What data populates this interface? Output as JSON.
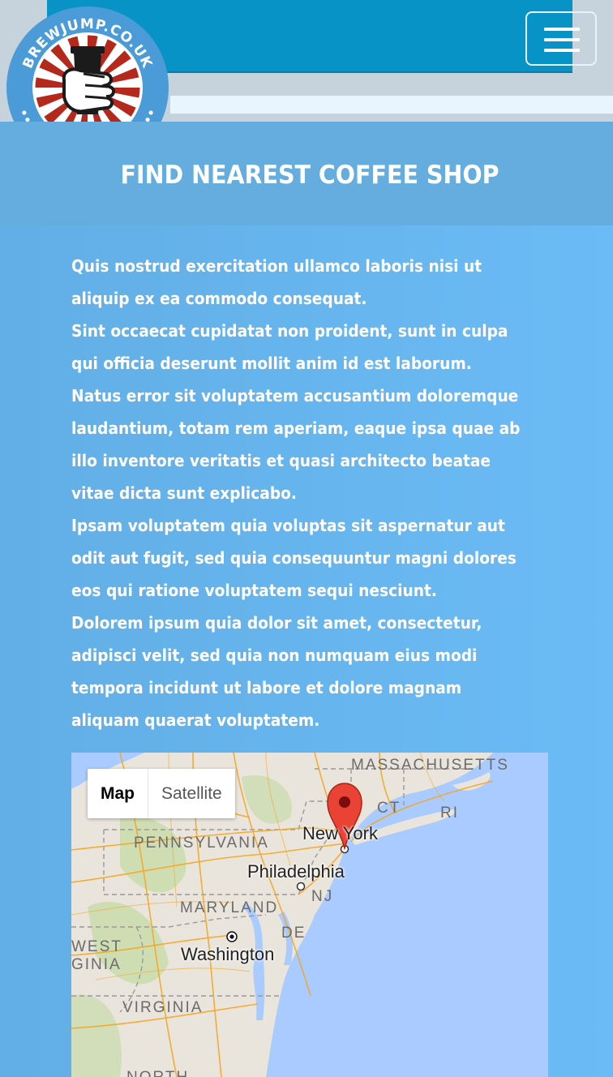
{
  "header": {
    "logo_text": "BREWJUMP.CO.UK",
    "menu_icon": "hamburger-menu-icon"
  },
  "page": {
    "title": "FIND NEAREST COFFEE SHOP",
    "paragraph_lines": [
      "Quis nostrud exercitation ullamco laboris nisi ut",
      "aliquip ex ea commodo consequat.",
      "Sint occaecat cupidatat non proident, sunt in culpa",
      "qui officia deserunt mollit anim id est laborum.",
      "Natus error sit voluptatem accusantium doloremque",
      "laudantium, totam rem aperiam, eaque ipsa quae ab",
      "illo inventore veritatis et quasi architecto beatae",
      "vitae dicta sunt explicabo.",
      "Ipsam voluptatem quia voluptas sit aspernatur aut",
      "odit aut fugit, sed quia consequuntur magni dolores",
      "eos qui ratione voluptatem sequi nesciunt.",
      "Dolorem ipsum quia dolor sit amet, consectetur,",
      "adipisci velit, sed quia non numquam eius modi",
      "tempora incidunt ut labore et dolore magnam",
      "aliquam quaerat voluptatem."
    ]
  },
  "map": {
    "type_controls": {
      "map": "Map",
      "satellite": "Satellite",
      "selected": "Map"
    },
    "states": {
      "massachusetts": "MASSACHUSETTS",
      "ct": "CT",
      "ri": "RI",
      "pennsylvania": "PENNSYLVANIA",
      "nj": "NJ",
      "maryland": "MARYLAND",
      "de": "DE",
      "west": "WEST",
      "ginia": "GINIA",
      "virginia": "VIRGINIA",
      "north": "NORTH"
    },
    "cities": {
      "new_york": "New York",
      "philadelphia": "Philadelphia",
      "washington": "Washington"
    },
    "marker_icon": "map-pin-icon",
    "colors": {
      "water": "#aacbff",
      "land": "#e9e5dc",
      "roads": "#f5a623",
      "parks": "#c8dba9"
    }
  },
  "colors": {
    "topbar_panel": "#0893c6",
    "title_band": "#66addf",
    "content_bg": "#6bbbf6",
    "logo_red": "#b5281c",
    "logo_blue": "#4a9bd8"
  }
}
